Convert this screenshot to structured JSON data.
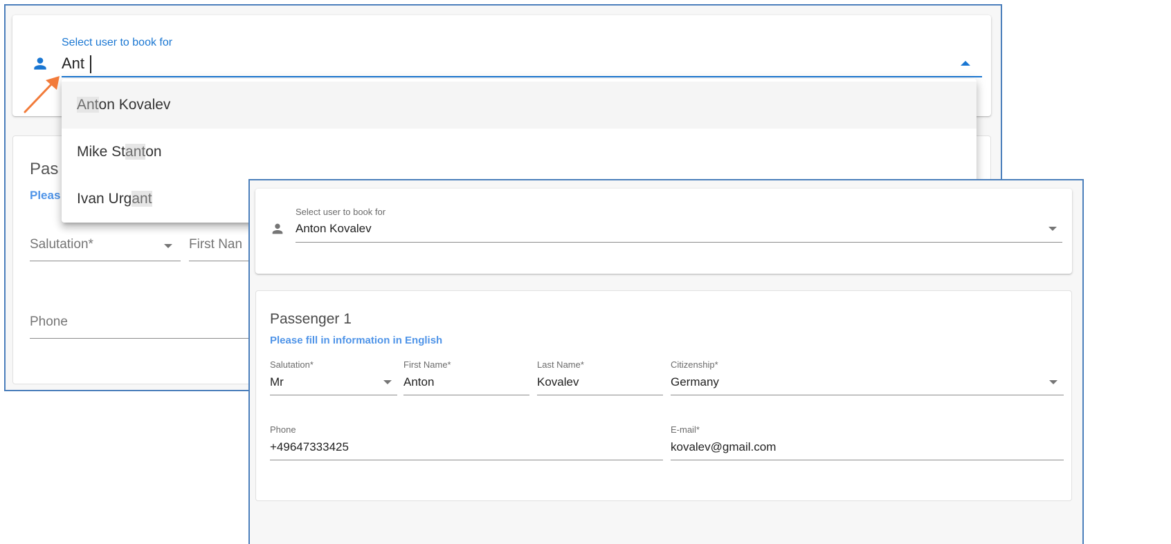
{
  "back": {
    "user_select": {
      "label": "Select user to book for",
      "value": "Ant"
    },
    "suggestions": [
      {
        "pre": "",
        "match": "Ant",
        "post": "on Kovalev"
      },
      {
        "pre": "Mike St",
        "match": "ant",
        "post": "on"
      },
      {
        "pre": "Ivan Urg",
        "match": "ant",
        "post": ""
      }
    ],
    "passenger_title_partial": "Pas",
    "hint_partial": "Pleas",
    "salutation_label": "Salutation*",
    "first_name_partial": "First Nan",
    "phone_label": "Phone"
  },
  "front": {
    "user_select": {
      "label": "Select user to book for",
      "value": "Anton Kovalev"
    },
    "passenger": {
      "title": "Passenger 1",
      "hint": "Please fill in information in English",
      "salutation": {
        "label": "Salutation*",
        "value": "Mr"
      },
      "first_name": {
        "label": "First Name*",
        "value": "Anton"
      },
      "last_name": {
        "label": "Last Name*",
        "value": "Kovalev"
      },
      "citizenship": {
        "label": "Citizenship*",
        "value": "Germany"
      },
      "phone": {
        "label": "Phone",
        "value": "+49647333425"
      },
      "email": {
        "label": "E-mail*",
        "value": "kovalev@gmail.com"
      }
    }
  },
  "icons": {
    "person": "person-icon",
    "arrow": "orange-annotation-arrow",
    "dropdown": "dropdown-arrow-icon"
  },
  "colors": {
    "accent": "#1976d2",
    "hint": "#4f94e8",
    "frame_border": "#4a7ebb",
    "annotation": "#f27b3a"
  }
}
